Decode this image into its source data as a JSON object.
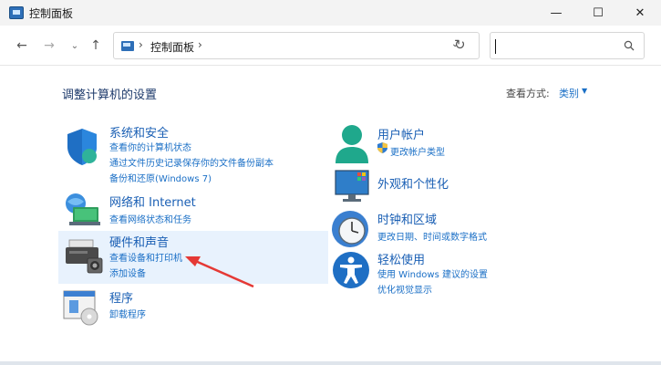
{
  "window": {
    "title": "控制面板",
    "controls": {
      "minimize": "—",
      "maximize": "☐",
      "close": "✕"
    }
  },
  "nav": {
    "back": "←",
    "forward": "→",
    "recent": "⌄",
    "up": "↑",
    "address_icon": "control-panel-icon",
    "address_separator": "›",
    "address_text": "控制面板",
    "address_dropdown": "⌄",
    "refresh": "↻",
    "search_placeholder": ""
  },
  "page": {
    "title": "调整计算机的设置",
    "view_by_label": "查看方式:",
    "view_by_value": "类别",
    "view_by_caret": "▼"
  },
  "categories": {
    "system": {
      "icon": "shield-icon",
      "title": "系统和安全",
      "links": [
        "查看你的计算机状态",
        "通过文件历史记录保存你的文件备份副本",
        "备份和还原(Windows 7)"
      ]
    },
    "network": {
      "icon": "network-icon",
      "title": "网络和 Internet",
      "links": [
        "查看网络状态和任务"
      ]
    },
    "hardware": {
      "icon": "printer-icon",
      "title": "硬件和声音",
      "links": [
        "查看设备和打印机",
        "添加设备"
      ]
    },
    "programs": {
      "icon": "programs-icon",
      "title": "程序",
      "links": [
        "卸载程序"
      ]
    },
    "users": {
      "icon": "user-icon",
      "title": "用户帐户",
      "links": [
        "更改帐户类型"
      ]
    },
    "appearance": {
      "icon": "monitor-icon",
      "title": "外观和个性化",
      "links": []
    },
    "clock": {
      "icon": "clock-icon",
      "title": "时钟和区域",
      "links": [
        "更改日期、时间或数字格式"
      ]
    },
    "ease": {
      "icon": "accessibility-icon",
      "title": "轻松使用",
      "links": [
        "使用 Windows 建议的设置",
        "优化视觉显示"
      ]
    }
  },
  "colors": {
    "link": "#1a6fc6",
    "title_link": "#1a5fb4",
    "highlight": "#e8f2fd",
    "arrow": "#e53935"
  }
}
